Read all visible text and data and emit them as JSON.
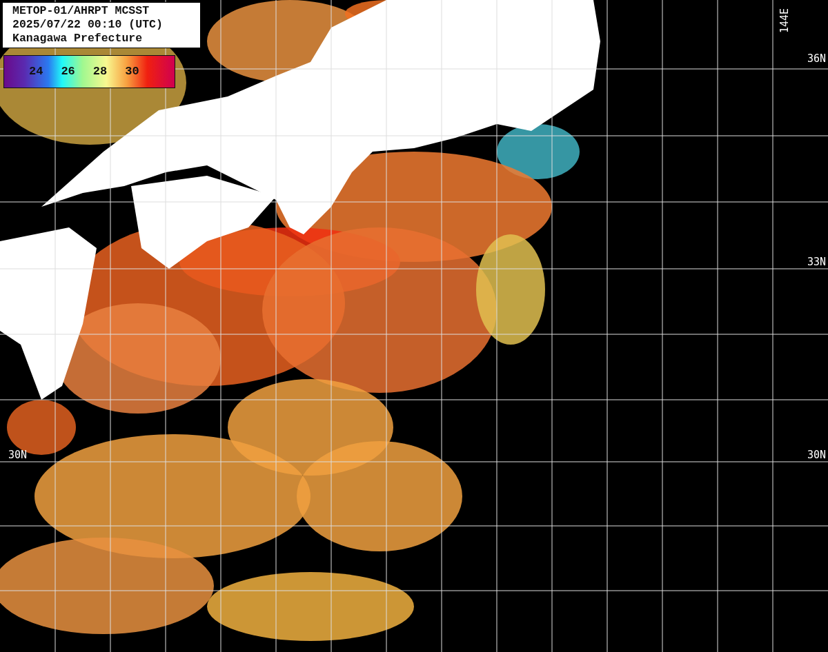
{
  "header": {
    "lines": [
      "METOP-01/AHRPT MCSST",
      "2025/07/22 00:10 (UTC)",
      "Kanagawa Prefecture"
    ]
  },
  "legend": {
    "labels": [
      "24",
      "26",
      "28",
      "30"
    ]
  },
  "map": {
    "longitude_labels": [
      "144E"
    ],
    "latitude_labels_right": [
      "36N",
      "33N",
      "30N"
    ],
    "latitude_labels_left": [
      "30N"
    ]
  }
}
